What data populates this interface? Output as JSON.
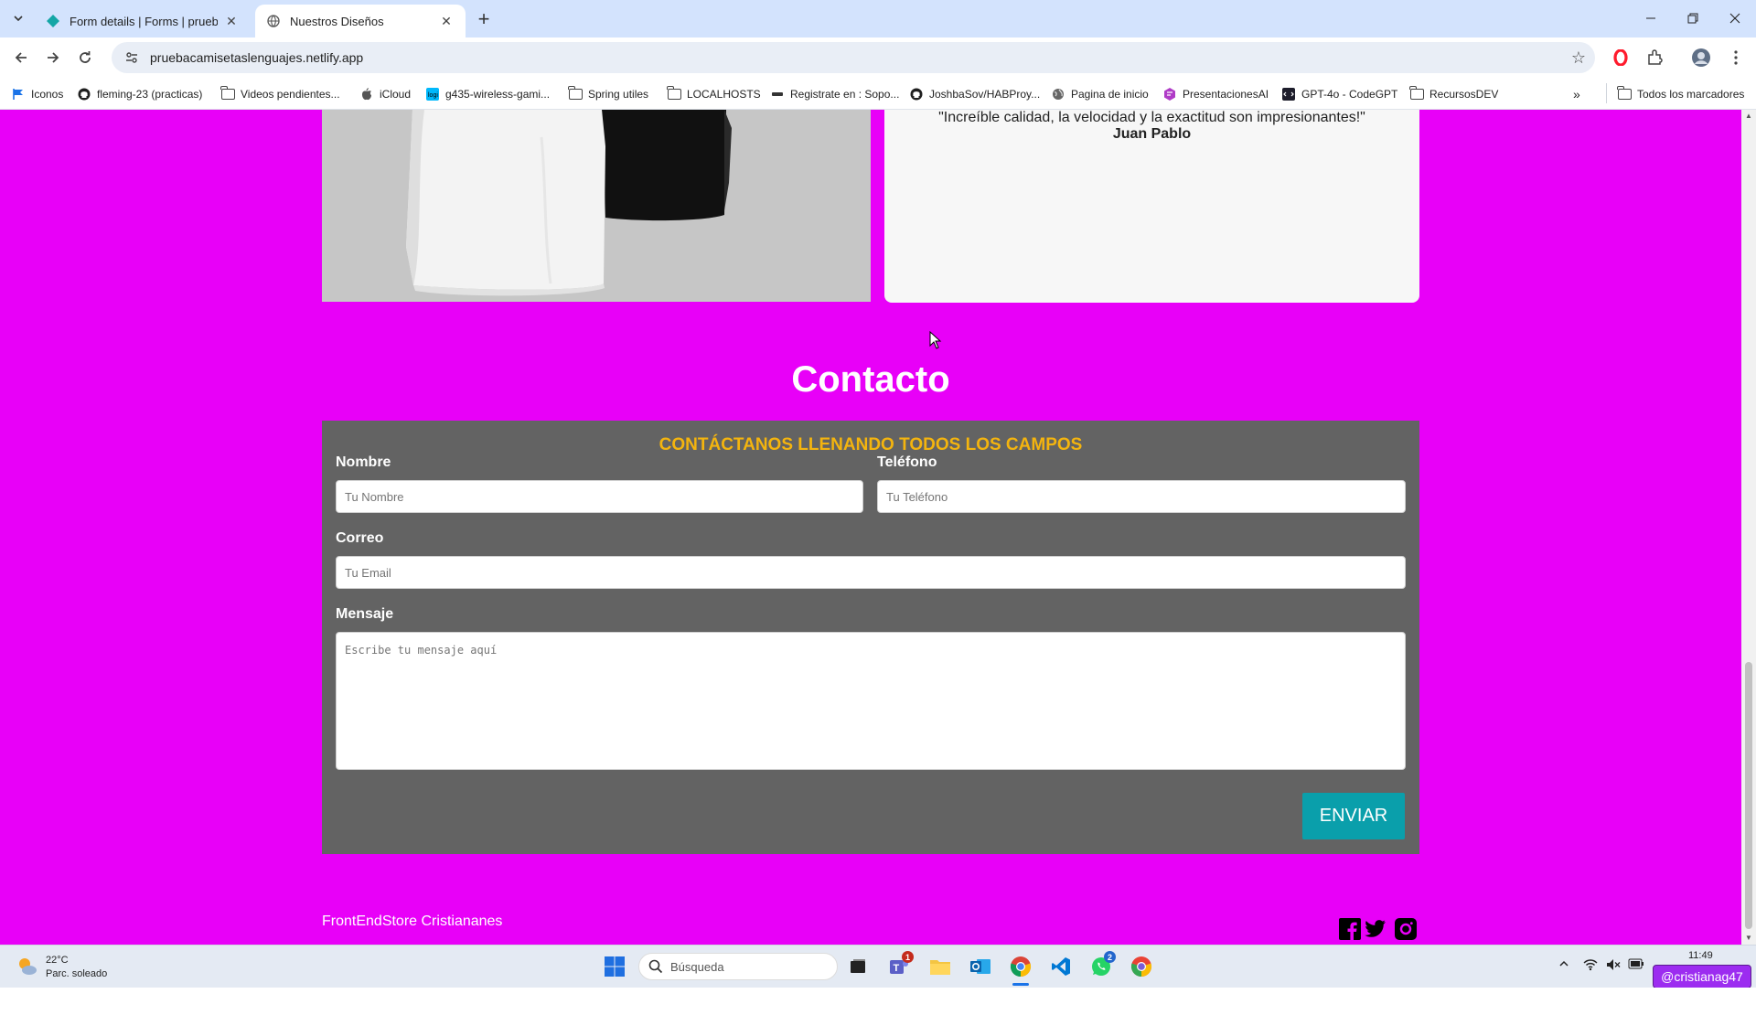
{
  "browser": {
    "tabs": [
      {
        "title": "Form details | Forms | pruebaca",
        "active": false
      },
      {
        "title": "Nuestros Diseños",
        "active": true
      }
    ],
    "url": "pruebacamisetaslenguajes.netlify.app",
    "bookmarks": [
      {
        "label": "Iconos",
        "icon": "flag-icon"
      },
      {
        "label": "fleming-23 (practicas)",
        "icon": "github-icon"
      },
      {
        "label": "Videos pendientes...",
        "icon": "folder-icon"
      },
      {
        "label": "iCloud",
        "icon": "apple-icon"
      },
      {
        "label": "g435-wireless-gami...",
        "icon": "logitech-icon"
      },
      {
        "label": "Spring utiles",
        "icon": "folder-icon"
      },
      {
        "label": "LOCALHOSTS",
        "icon": "folder-icon"
      },
      {
        "label": "Registrate en : Sopo...",
        "icon": "sopo-icon"
      },
      {
        "label": "JoshbaSov/HABProy...",
        "icon": "github-icon"
      },
      {
        "label": "Pagina de inicio",
        "icon": "globe-icon"
      },
      {
        "label": "PresentacionesAI",
        "icon": "presentations-icon"
      },
      {
        "label": "GPT-4o - CodeGPT",
        "icon": "codegpt-icon"
      },
      {
        "label": "RecursosDEV",
        "icon": "folder-icon"
      }
    ],
    "more_bookmarks": "»",
    "all_bookmarks": "Todos los marcadores"
  },
  "page": {
    "testimonial": {
      "quote": "\"Increíble calidad, la velocidad y la exactitud son impresionantes!\"",
      "author": "Juan Pablo"
    },
    "contact": {
      "title": "Contacto",
      "form_heading": "CONTÁCTANOS LLENANDO TODOS LOS CAMPOS",
      "name_label": "Nombre",
      "name_placeholder": "Tu Nombre",
      "phone_label": "Teléfono",
      "phone_placeholder": "Tu Teléfono",
      "email_label": "Correo",
      "email_placeholder": "Tu Email",
      "message_label": "Mensaje",
      "message_placeholder": "Escribe tu mensaje aquí",
      "submit_label": "ENVIAR"
    },
    "footer": {
      "brand": "FrontEndStore Cristiananes",
      "social": [
        "facebook-icon",
        "twitter-icon",
        "instagram-icon"
      ]
    },
    "colors": {
      "background": "#e800f8",
      "form_bg": "#636363",
      "heading_accent": "#f4b40e",
      "button": "#0a9fab"
    }
  },
  "taskbar": {
    "weather_temp": "22°C",
    "weather_desc": "Parc. soleado",
    "search_placeholder": "Búsqueda",
    "clock_time": "11:49",
    "user_badge": "@cristianag47",
    "teams_badge": "1",
    "whatsapp_badge": "2"
  }
}
